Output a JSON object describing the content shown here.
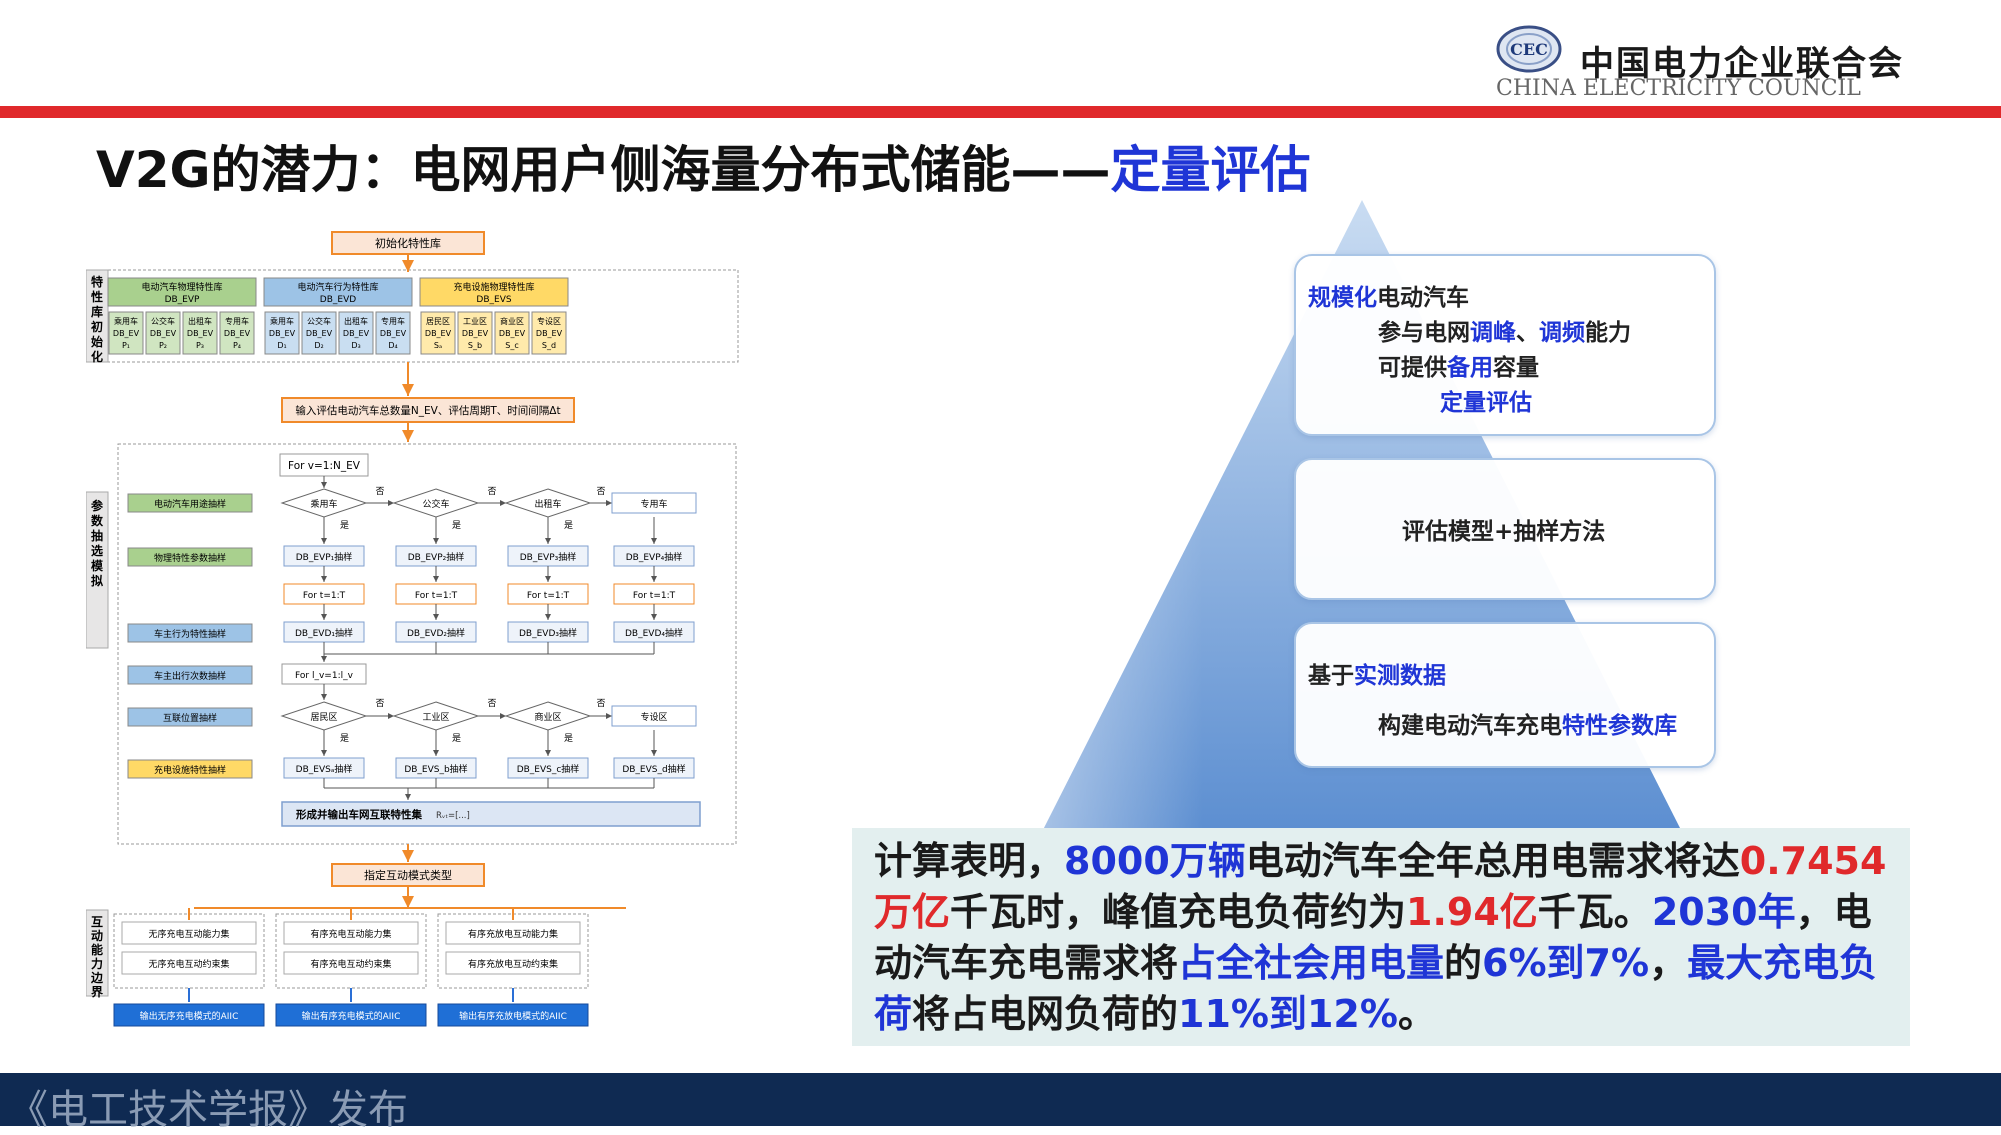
{
  "header": {
    "org_name_cn": "中国电力企业联合会",
    "org_name_en": "CHINA ELECTRICITY COUNCIL",
    "logo_letters": "CEC",
    "brand_red": "#e0292b"
  },
  "title": {
    "prefix": "V2G的潜力：电网用户侧海量分布式储能——",
    "highlight": "定量评估",
    "highlight_color": "#1f35d6"
  },
  "flowchart": {
    "init_lib": "初始化特性库",
    "section_init": "特性库初始化",
    "section_sim": "参数抽选模拟",
    "section_boundary": "互动能力边界",
    "libs": [
      {
        "name": "电动汽车物理特性库",
        "code": "DB_EVP",
        "items": [
          "乘用车 DB_EV P₁",
          "公交车 DB_EV P₂",
          "出租车 DB_EV P₃",
          "专用车 DB_EV P₄"
        ],
        "color": "#a9d08e"
      },
      {
        "name": "电动汽车行为特性库",
        "code": "DB_EVD",
        "items": [
          "乘用车 DB_EV D₁",
          "公交车 DB_EV D₂",
          "出租车 DB_EV D₃",
          "专用车 DB_EV D₄"
        ],
        "color": "#9dc3e6"
      },
      {
        "name": "充电设施物理特性库",
        "code": "DB_EVS",
        "items": [
          "居民区 DB_EV Sₐ",
          "工业区 DB_EV S_b",
          "商业区 DB_EV S_c",
          "专设区 DB_EV S_d"
        ],
        "color": "#ffd966"
      }
    ],
    "input_box": "输入评估电动汽车总数量N_EV、评估周期T、时间间隔Δt",
    "for_v": "For v=1:N_EV",
    "left_labels": [
      {
        "text": "电动汽车用途抽样",
        "color": "#a9d08e"
      },
      {
        "text": "物理特性参数抽样",
        "color": "#a9d08e"
      },
      {
        "text": "车主行为特性抽样",
        "color": "#9dc3e6"
      },
      {
        "text": "车主出行次数抽样",
        "color": "#9dc3e6"
      },
      {
        "text": "互联位置抽样",
        "color": "#9dc3e6"
      },
      {
        "text": "充电设施特性抽样",
        "color": "#ffd966"
      }
    ],
    "vehicles": [
      "乘用车",
      "公交车",
      "出租车",
      "专用车"
    ],
    "evp_samples": [
      "DB_EVP₁抽样",
      "DB_EVP₂抽样",
      "DB_EVP₃抽样",
      "DB_EVP₄抽样"
    ],
    "for_t": "For t=1:T",
    "evd_samples": [
      "DB_EVD₁抽样",
      "DB_EVD₂抽样",
      "DB_EVD₃抽样",
      "DB_EVD₄抽样"
    ],
    "for_l": "For l_v=1:l_v",
    "zones": [
      "居民区",
      "工业区",
      "商业区",
      "专设区"
    ],
    "evs_samples": [
      "DB_EVSₐ抽样",
      "DB_EVS_b抽样",
      "DB_EVS_c抽样",
      "DB_EVS_d抽样"
    ],
    "yes": "是",
    "no": "否",
    "output_box": "形成并输出车网互联特性集",
    "output_formula": "Rᵥₜ=[...]",
    "mode_box": "指定互动模式类型",
    "modes": [
      {
        "cap": "无序充电互动能力集",
        "con": "无序充电互动约束集",
        "out": "输出无序充电模式的AIIC"
      },
      {
        "cap": "有序充电互动能力集",
        "con": "有序充电互动约束集",
        "out": "输出有序充电模式的AIIC"
      },
      {
        "cap": "有序充放电互动能力集",
        "con": "有序充放电互动约束集",
        "out": "输出有序充放电模式的AIIC"
      }
    ]
  },
  "pyramid": {
    "box1": {
      "l1_hl": "规模化",
      "l1_rest": "电动汽车",
      "l2_a": "参与电网",
      "l2_b": "调峰",
      "l2_c": "、",
      "l2_d": "调频",
      "l2_e": "能力",
      "l3_a": "可提供",
      "l3_b": "备用",
      "l3_c": "容量",
      "l4": "定量评估"
    },
    "box2": {
      "text": "评估模型+抽样方法"
    },
    "box3": {
      "l1_a": "基于",
      "l1_b": "实测数据",
      "l2_a": "构建电动汽车充电",
      "l2_b": "特性参数库"
    },
    "color_top": "#c9dcf2",
    "color_bottom": "#5d8fd1"
  },
  "conclusion": {
    "s1": "计算表明，",
    "s2": "8000万辆",
    "s3": "电动汽车全年总用电需求将达",
    "s4": "0.7454万亿",
    "s5": "千瓦时，峰值充电负荷约为",
    "s6": "1.94亿",
    "s7": "千瓦。",
    "s8": "2030年",
    "s9": "，电动汽车充电需求将",
    "s10": "占全社会用电量",
    "s11": "的",
    "s12": "6%到7%",
    "s13": "，",
    "s14": "最大充电负荷",
    "s15": "将占电网负荷的",
    "s16": "11%到12%",
    "s17": "。",
    "bg_color": "#e3efef"
  },
  "footer": {
    "text": "《电工技术学报》发布",
    "bg_color": "#0f2a52"
  }
}
